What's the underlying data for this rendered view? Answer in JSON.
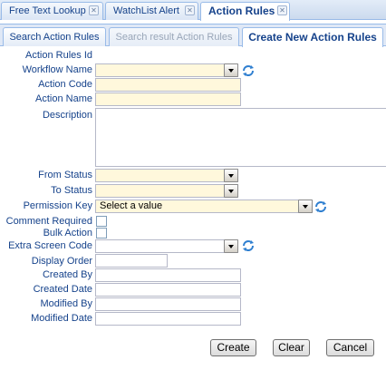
{
  "top_tabs": [
    {
      "label": "Free Text Lookup"
    },
    {
      "label": "WatchList Alert"
    },
    {
      "label": "Action Rules"
    }
  ],
  "sub_tabs": [
    {
      "label": "Search Action Rules"
    },
    {
      "label": "Search result Action Rules"
    },
    {
      "label": "Create New Action Rules"
    }
  ],
  "form": {
    "action_rules_id": "Action Rules Id",
    "workflow_name": "Workflow Name",
    "action_code": "Action Code",
    "action_name": "Action Name",
    "description": "Description",
    "from_status": "From Status",
    "to_status": "To Status",
    "permission_key": "Permission Key",
    "permission_key_value": "Select a value",
    "comment_required": "Comment Required",
    "bulk_action": "Bulk Action",
    "extra_screen_code": "Extra Screen Code",
    "display_order": "Display Order",
    "created_by": "Created By",
    "created_date": "Created Date",
    "modified_by": "Modified By",
    "modified_date": "Modified Date"
  },
  "buttons": {
    "create": "Create",
    "clear": "Clear",
    "cancel": "Cancel"
  }
}
